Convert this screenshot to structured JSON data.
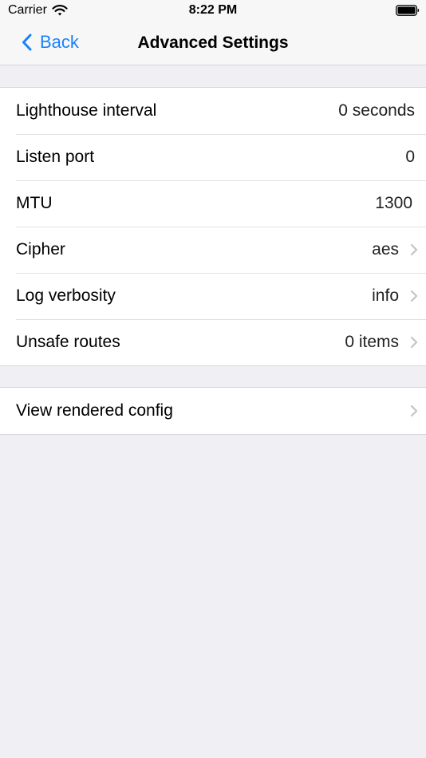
{
  "status_bar": {
    "carrier": "Carrier",
    "time": "8:22 PM"
  },
  "nav": {
    "back_label": "Back",
    "title": "Advanced Settings"
  },
  "settings": {
    "lighthouse_interval": {
      "label": "Lighthouse interval",
      "value": "0 seconds"
    },
    "listen_port": {
      "label": "Listen port",
      "value": "0"
    },
    "mtu": {
      "label": "MTU",
      "value": "1300"
    },
    "cipher": {
      "label": "Cipher",
      "value": "aes"
    },
    "log_verbosity": {
      "label": "Log verbosity",
      "value": "info"
    },
    "unsafe_routes": {
      "label": "Unsafe routes",
      "value": "0 items"
    }
  },
  "config": {
    "view_rendered_config": "View rendered config"
  },
  "colors": {
    "accent": "#1a82fb",
    "background": "#efeff4",
    "chevron": "#c4c4c9"
  }
}
